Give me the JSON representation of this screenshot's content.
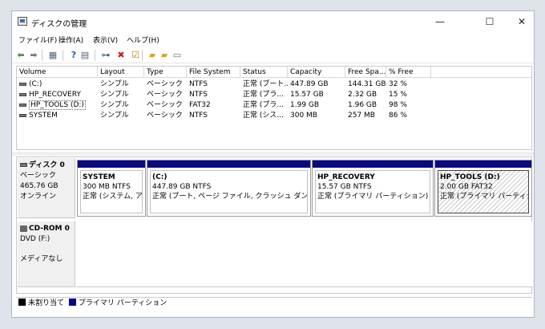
{
  "window": {
    "title": "ディスクの管理"
  },
  "controls": {
    "minimize": "—",
    "maximize": "☐",
    "close": "✕"
  },
  "menu": [
    {
      "label": "ファイル(F)"
    },
    {
      "label": "操作(A)"
    },
    {
      "label": "表示(V)"
    },
    {
      "label": "ヘルプ(H)"
    }
  ],
  "toolbar": [
    {
      "icon": "back-arrow-icon",
      "glyph": "⬅",
      "color": "#5a8a4a"
    },
    {
      "icon": "forward-arrow-icon",
      "glyph": "➡",
      "color": "#7a7a7a"
    },
    {
      "icon": "console-tree-icon",
      "glyph": "▦",
      "color": "#556677"
    },
    {
      "icon": "help-icon",
      "glyph": "?",
      "color": "#2b5fb0"
    },
    {
      "icon": "list-view-icon",
      "glyph": "▤",
      "color": "#556677"
    },
    {
      "icon": "connect-icon",
      "glyph": "⊶",
      "color": "#4a6a8a"
    },
    {
      "icon": "delete-icon",
      "glyph": "✖",
      "color": "#d01818"
    },
    {
      "icon": "check-icon",
      "glyph": "☑",
      "color": "#c07a20"
    },
    {
      "icon": "folder-icon",
      "glyph": "▰",
      "color": "#d9a620"
    },
    {
      "icon": "search-folder-icon",
      "glyph": "▰",
      "color": "#d9a620"
    },
    {
      "icon": "properties-icon",
      "glyph": "▭",
      "color": "#557799"
    }
  ],
  "volumes": {
    "columns": [
      "Volume",
      "Layout",
      "Type",
      "File System",
      "Status",
      "Capacity",
      "Free Spa...",
      "% Free"
    ],
    "rows": [
      {
        "volume": "(C:)",
        "layout": "シンプル",
        "type": "ベーシック",
        "fs": "NTFS",
        "status": "正常 (ブート...",
        "capacity": "447.89 GB",
        "free": "144.31 GB",
        "pct": "32 %"
      },
      {
        "volume": "HP_RECOVERY",
        "layout": "シンプル",
        "type": "ベーシック",
        "fs": "NTFS",
        "status": "正常 (プラ...",
        "capacity": "15.57 GB",
        "free": "2.32 GB",
        "pct": "15 %"
      },
      {
        "volume": "HP_TOOLS (D:)",
        "layout": "シンプル",
        "type": "ベーシック",
        "fs": "FAT32",
        "status": "正常 (プラ...",
        "capacity": "1.99 GB",
        "free": "1.96 GB",
        "pct": "98 %"
      },
      {
        "volume": "SYSTEM",
        "layout": "シンプル",
        "type": "ベーシック",
        "fs": "NTFS",
        "status": "正常 (シス...",
        "capacity": "300 MB",
        "free": "257 MB",
        "pct": "86 %"
      }
    ]
  },
  "disk0": {
    "name": "ディスク 0",
    "type": "ベーシック",
    "size": "465.76 GB",
    "status": "オンライン",
    "partitions": [
      {
        "name": "SYSTEM",
        "size": "300 MB NTFS",
        "status": "正常 (システム, アクティ"
      },
      {
        "name": "(C:)",
        "size": "447.89 GB NTFS",
        "status": "正常 (ブート, ページ ファイル, クラッシュ ダンプ, プライマ"
      },
      {
        "name": "HP_RECOVERY",
        "size": "15.57 GB NTFS",
        "status": "正常 (プライマリ パーティション)"
      },
      {
        "name": "HP_TOOLS  (D:)",
        "size": "2.00 GB FAT32",
        "status": "正常 (プライマリ パーティション)"
      }
    ]
  },
  "cdrom0": {
    "name": "CD-ROM 0",
    "drive": "DVD (F:)",
    "media": "メディアなし"
  },
  "legend": [
    {
      "label": "未割り当て",
      "color": "#000000"
    },
    {
      "label": "プライマリ パーティション",
      "color": "#0a0a80"
    }
  ]
}
